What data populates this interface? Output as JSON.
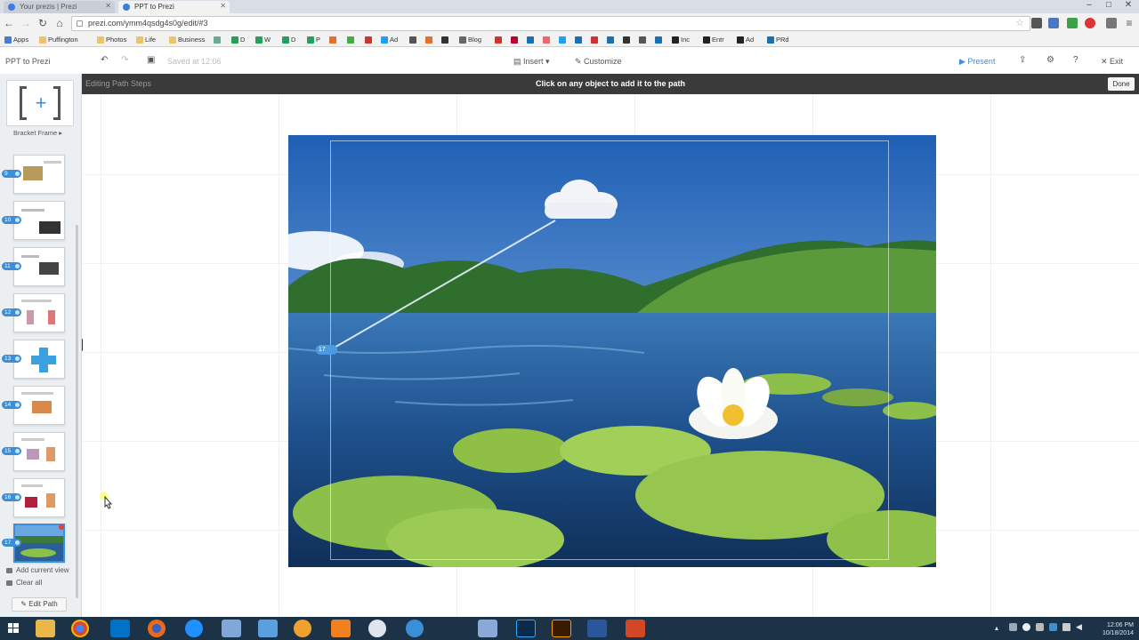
{
  "browser": {
    "tabs": [
      {
        "title": "Your prezis | Prezi",
        "active": false
      },
      {
        "title": "PPT to Prezi",
        "active": true
      }
    ],
    "url": "prezi.com/ymm4qsdg4s0g/edit/#3",
    "bookmarks": [
      "Apps",
      "Puffington",
      "Photos",
      "Life",
      "Business",
      "D",
      "W",
      "D",
      "P",
      "Ad",
      "Blog",
      "Inc",
      "Entr",
      "Ad",
      "PRd"
    ]
  },
  "prezi": {
    "doc_title": "PPT to Prezi",
    "saved_text": "Saved at 12:06",
    "insert_label": "Insert",
    "customize_label": "Customize",
    "present_label": "Present",
    "exit_label": "Exit"
  },
  "pathbar": {
    "left_label": "Editing Path Steps",
    "instruction": "Click on any object to add it to the path",
    "done_label": "Done"
  },
  "sidebar": {
    "frame_label": "Bracket Frame",
    "steps": [
      {
        "number": "9"
      },
      {
        "number": "10"
      },
      {
        "number": "11"
      },
      {
        "number": "12"
      },
      {
        "number": "13"
      },
      {
        "number": "14"
      },
      {
        "number": "15"
      },
      {
        "number": "16"
      },
      {
        "number": "17"
      }
    ],
    "add_current_view": "Add current view",
    "clear_all": "Clear all",
    "edit_path": "Edit Path"
  },
  "canvas": {
    "path_handle_number": "17"
  },
  "taskbar": {
    "time": "12:06 PM",
    "date": "10/18/2014"
  },
  "colors": {
    "prezi_blue": "#3a8fd8",
    "pathbar_bg": "#3a3a3a",
    "taskbar_bg": "#1c3347"
  }
}
